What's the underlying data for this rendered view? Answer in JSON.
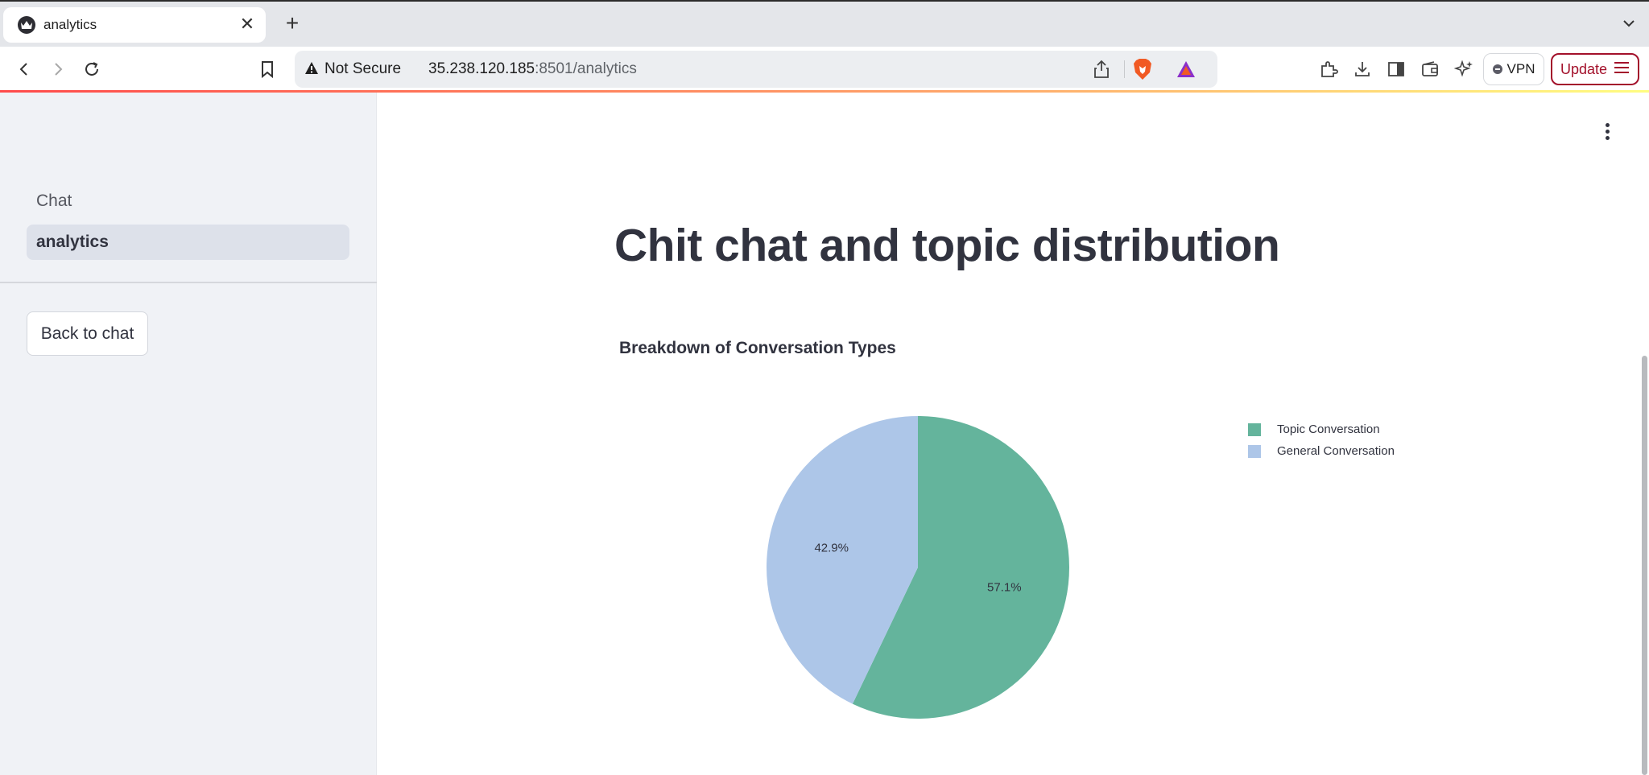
{
  "browser": {
    "tab": {
      "title": "analytics",
      "close": "✕"
    },
    "new_tab": "+",
    "security_label": "Not Secure",
    "url_host": "35.238.120.185",
    "url_path": ":8501/analytics",
    "vpn_label": "VPN",
    "update_label": "Update"
  },
  "sidebar": {
    "items": [
      {
        "label": "Chat",
        "active": false
      },
      {
        "label": "analytics",
        "active": true
      }
    ],
    "back_button": "Back to chat"
  },
  "main": {
    "title": "Chit chat and topic distribution"
  },
  "chart_data": {
    "type": "pie",
    "title": "Breakdown of Conversation Types",
    "slices": [
      {
        "label": "Topic Conversation",
        "value": 57.1,
        "display": "57.1%",
        "color": "#64b49c"
      },
      {
        "label": "General Conversation",
        "value": 42.9,
        "display": "42.9%",
        "color": "#adc6e8"
      }
    ],
    "legend_position": "top-right",
    "start_angle": "12 o'clock",
    "direction": "clockwise"
  }
}
